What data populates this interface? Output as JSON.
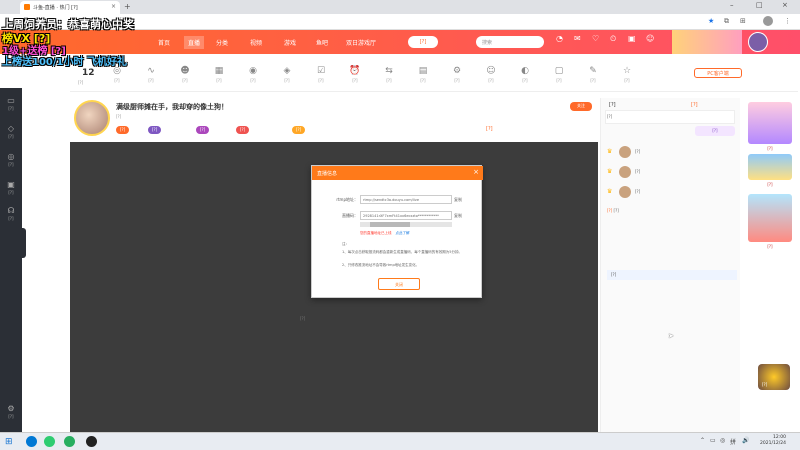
{
  "browser": {
    "tab_title": "斗鱼-直播 · 热门 [?]",
    "tab_close": "×",
    "new_tab": "+",
    "url": "[?]",
    "controls": {
      "minimize": "–",
      "maximize": "□",
      "close": "×"
    }
  },
  "overlay": {
    "line1": "上周饲养员：恭喜萌心中奖",
    "line2": "榜VX  [?]",
    "line3": "1级+送榜  [?]",
    "line4": "上榜送100/1小时 飞机好礼"
  },
  "header": {
    "nav": [
      "首页",
      "直播",
      "分类",
      "视频",
      "游戏",
      "鱼吧",
      "双日游戏厅"
    ],
    "active_index": 1,
    "search_placeholder": "搜索",
    "promo_btn": "[?]",
    "icons": [
      {
        "glyph": "◔",
        "label": "[?]"
      },
      {
        "glyph": "✉",
        "label": "[?]"
      },
      {
        "glyph": "♡",
        "label": "[?]"
      },
      {
        "glyph": "⏲",
        "label": "[?]"
      },
      {
        "glyph": "▣",
        "label": "[?]"
      },
      {
        "glyph": "☺",
        "label": "[?]"
      }
    ]
  },
  "toolbar": {
    "level": "12",
    "level_label": "[?]",
    "tools": [
      {
        "glyph": "◎",
        "label": "[?]"
      },
      {
        "glyph": "∿",
        "label": "[?]"
      },
      {
        "glyph": "☻",
        "label": "[?]"
      },
      {
        "glyph": "▦",
        "label": "[?]"
      },
      {
        "glyph": "◉",
        "label": "[?]"
      },
      {
        "glyph": "◈",
        "label": "[?]"
      },
      {
        "glyph": "☑",
        "label": "[?]"
      },
      {
        "glyph": "⏰",
        "label": "[?]"
      },
      {
        "glyph": "⇆",
        "label": "[?]"
      },
      {
        "glyph": "▤",
        "label": "[?]"
      },
      {
        "glyph": "⚙",
        "label": "[?]"
      },
      {
        "glyph": "☺",
        "label": "[?]"
      },
      {
        "glyph": "◐",
        "label": "[?]"
      },
      {
        "glyph": "▢",
        "label": "[?]"
      },
      {
        "glyph": "✎",
        "label": "[?]"
      },
      {
        "glyph": "☆",
        "label": "[?]"
      }
    ],
    "pc_button": "PC客户端"
  },
  "leftbar": {
    "items": [
      {
        "glyph": "▭",
        "label": "[?]"
      },
      {
        "glyph": "◇",
        "label": "[?]"
      },
      {
        "glyph": "◎",
        "label": "[?]"
      },
      {
        "glyph": "▣",
        "label": "[?]"
      },
      {
        "glyph": "☊",
        "label": "[?]"
      },
      {
        "glyph": "⚙",
        "label": "[?]"
      }
    ]
  },
  "room": {
    "title": "满级厨师摊在手，我却穿的像土狗！",
    "meta": "[?]",
    "follow": "关注",
    "rank": "[?]",
    "pills": [
      {
        "text": "[?]",
        "color": "#ff6a2a"
      },
      {
        "text": "[?]",
        "color": "#7e57c2"
      },
      {
        "text": "[?]",
        "color": "#ab47bc"
      },
      {
        "text": "[?]",
        "color": "#ef5350"
      },
      {
        "text": "[?]",
        "color": "#ffa726"
      }
    ]
  },
  "video": {
    "caption": "[?]"
  },
  "modal": {
    "title": "直播信息",
    "close": "×",
    "rtmp_label": "rtmp地址：",
    "rtmp_value": "rtmp://sendtc3a.douyu.com/live",
    "key_label": "直播码：",
    "key_value": "2928141rXF7xmFt41xx6ecxzto************",
    "copy": "复制",
    "warning": "您的直播地址已上线",
    "warning_link": "点此了解",
    "note_title": "注：",
    "note1": "1、每次点击获取推流码都会重新生成直播码，每个直播码的有效期为5分钟。",
    "note2": "2、只修改推流地址不会导致rtmp地址发生变化。",
    "button": "关闭"
  },
  "right": {
    "tab1": "[?]",
    "tab2": "[?]",
    "row1": "[?]",
    "badge": "[?]",
    "fans": [
      {
        "rank": "♛",
        "name": "[?]"
      },
      {
        "rank": "♛",
        "name": "[?]"
      },
      {
        "rank": "♛",
        "name": "[?]"
      }
    ],
    "chat_sys": "[?]",
    "chat_body": "[?]",
    "chat2": "[?]"
  },
  "ads": {
    "label1": "[?]",
    "label2": "[?]",
    "label3": "[?]"
  },
  "mascot_label": "[?]",
  "taskbar": {
    "time": "12:00",
    "date": "2021/12/24",
    "tray": [
      "⌃",
      "▭",
      "◎",
      "拼",
      "🔊"
    ]
  },
  "colors": {
    "brand": "#ff6a2a",
    "modal_header": "#ff7a1a",
    "video_bg": "#3c3c3c"
  }
}
